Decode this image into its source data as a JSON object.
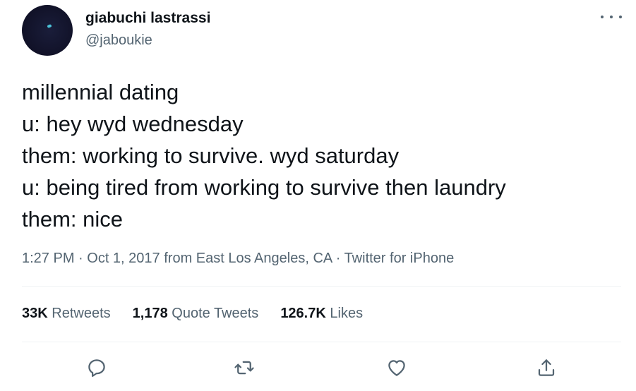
{
  "author": {
    "name": "giabuchi lastrassi",
    "handle": "@jaboukie"
  },
  "tweet": {
    "lines": [
      "millennial dating",
      "u: hey wyd wednesday",
      "them: working to survive. wyd saturday",
      "u: being tired from working to survive then laundry",
      "them: nice"
    ]
  },
  "meta": {
    "time": "1:27 PM",
    "sep1": " · ",
    "date": "Oct 1, 2017",
    "location": " from East Los Angeles, CA",
    "sep2": " · ",
    "source": "Twitter for iPhone"
  },
  "stats": {
    "retweets_count": "33K",
    "retweets_label": "Retweets",
    "quotes_count": "1,178",
    "quotes_label": "Quote Tweets",
    "likes_count": "126.7K",
    "likes_label": "Likes"
  },
  "icons": {
    "more": "more-horizontal-icon",
    "reply": "reply-icon",
    "retweet": "retweet-icon",
    "like": "heart-icon",
    "share": "share-icon"
  }
}
